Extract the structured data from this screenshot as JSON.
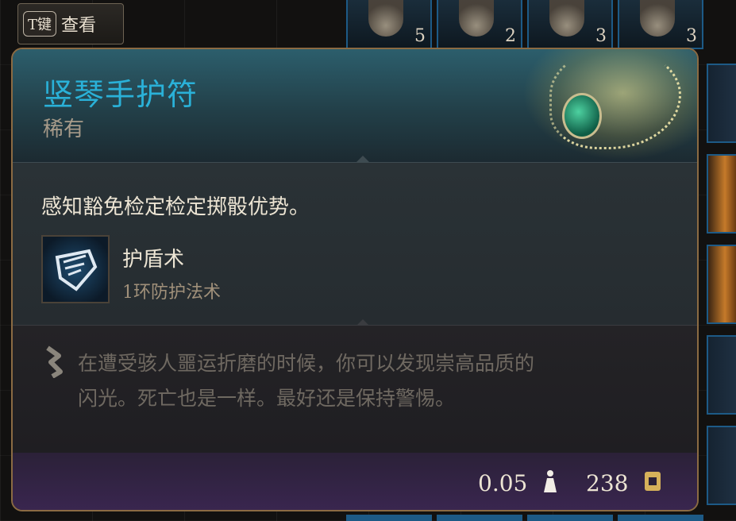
{
  "view_button": {
    "key": "T键",
    "label": "查看"
  },
  "inventory": {
    "top_slot_counts": [
      "5",
      "2",
      "3",
      "3"
    ]
  },
  "item": {
    "name": "竖琴手护符",
    "rarity": "稀有",
    "name_color": "#2ab1d8",
    "effect": "感知豁免检定检定掷骰优势。",
    "spell": {
      "name": "护盾术",
      "level": "1环防护法术",
      "icon": "shield-spell-icon"
    },
    "lore_line1": "在遭受骇人噩运折磨的时候，你可以发现崇高品质的",
    "lore_line2": "闪光。死亡也是一样。最好还是保持警惕。",
    "weight": "0.05",
    "price": "238"
  }
}
